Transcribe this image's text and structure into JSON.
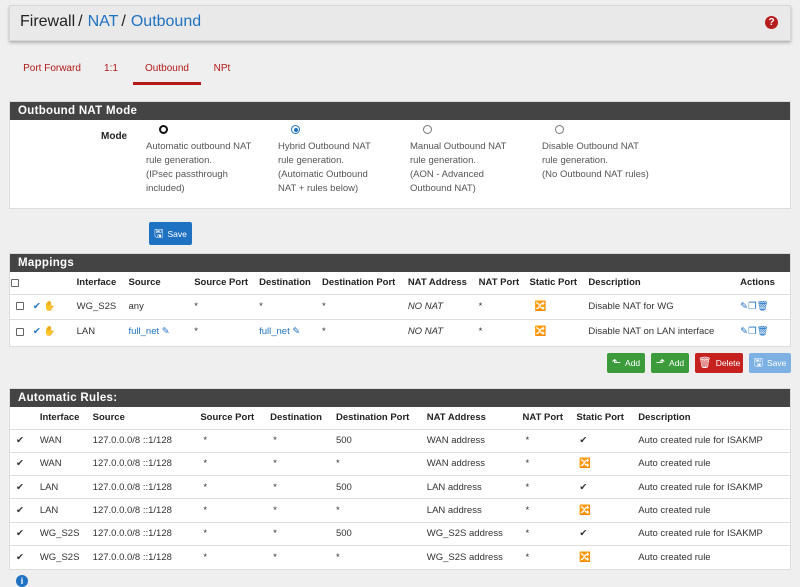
{
  "breadcrumb": {
    "part1": "Firewall",
    "sep1": "/",
    "part2": "NAT",
    "sep2": "/",
    "part3": "Outbound"
  },
  "help_icon": "?",
  "tabs": [
    {
      "label": "Port Forward",
      "active": false
    },
    {
      "label": "1:1",
      "active": false
    },
    {
      "label": "Outbound",
      "active": true
    },
    {
      "label": "NPt",
      "active": false
    }
  ],
  "mode_panel": {
    "title": "Outbound NAT Mode",
    "mode_label": "Mode",
    "options": [
      {
        "lines": [
          "Automatic outbound NAT",
          "rule generation.",
          "(IPsec passthrough",
          "included)"
        ],
        "selected": false,
        "focused": true
      },
      {
        "lines": [
          "Hybrid Outbound NAT",
          "rule generation.",
          "(Automatic Outbound",
          "NAT + rules below)"
        ],
        "selected": true,
        "focused": false
      },
      {
        "lines": [
          "Manual Outbound NAT",
          "rule generation.",
          "(AON - Advanced",
          "Outbound NAT)"
        ],
        "selected": false,
        "focused": false
      },
      {
        "lines": [
          "Disable Outbound NAT",
          "rule generation.",
          "(No Outbound NAT rules)"
        ],
        "selected": false,
        "focused": false
      }
    ],
    "save_label": "Save"
  },
  "mappings": {
    "title": "Mappings",
    "headers": [
      "Interface",
      "Source",
      "Source Port",
      "Destination",
      "Destination Port",
      "NAT Address",
      "NAT Port",
      "Static Port",
      "Description",
      "Actions"
    ],
    "rows": [
      {
        "interface": "WG_S2S",
        "source": "any",
        "source_port": "*",
        "destination": "*",
        "destination_port": "*",
        "nat_address": "NO NAT",
        "nat_port": "*",
        "static_port": "shuffle",
        "description": "Disable NAT for WG"
      },
      {
        "interface": "LAN",
        "source": "full_net",
        "source_port": "*",
        "destination": "full_net",
        "destination_port": "*",
        "nat_address": "NO NAT",
        "nat_port": "*",
        "static_port": "shuffle",
        "description": "Disable NAT on LAN interface"
      }
    ],
    "buttons": {
      "add_top": "Add",
      "add_bottom": "Add",
      "delete": "Delete",
      "save": "Save"
    }
  },
  "auto_rules": {
    "title": "Automatic Rules:",
    "headers": [
      "Interface",
      "Source",
      "Source Port",
      "Destination",
      "Destination Port",
      "NAT Address",
      "NAT Port",
      "Static Port",
      "Description"
    ],
    "rows": [
      {
        "interface": "WAN",
        "source": "127.0.0.0/8 ::1/128",
        "source_port": "*",
        "destination": "*",
        "destination_port": "500",
        "nat_address": "WAN address",
        "nat_port": "*",
        "static_port": "check",
        "description": "Auto created rule for ISAKMP"
      },
      {
        "interface": "WAN",
        "source": "127.0.0.0/8 ::1/128",
        "source_port": "*",
        "destination": "*",
        "destination_port": "*",
        "nat_address": "WAN address",
        "nat_port": "*",
        "static_port": "shuffle",
        "description": "Auto created rule"
      },
      {
        "interface": "LAN",
        "source": "127.0.0.0/8 ::1/128",
        "source_port": "*",
        "destination": "*",
        "destination_port": "500",
        "nat_address": "LAN address",
        "nat_port": "*",
        "static_port": "check",
        "description": "Auto created rule for ISAKMP"
      },
      {
        "interface": "LAN",
        "source": "127.0.0.0/8 ::1/128",
        "source_port": "*",
        "destination": "*",
        "destination_port": "*",
        "nat_address": "LAN address",
        "nat_port": "*",
        "static_port": "shuffle",
        "description": "Auto created rule"
      },
      {
        "interface": "WG_S2S",
        "source": "127.0.0.0/8 ::1/128",
        "source_port": "*",
        "destination": "*",
        "destination_port": "500",
        "nat_address": "WG_S2S address",
        "nat_port": "*",
        "static_port": "check",
        "description": "Auto created rule for ISAKMP"
      },
      {
        "interface": "WG_S2S",
        "source": "127.0.0.0/8 ::1/128",
        "source_port": "*",
        "destination": "*",
        "destination_port": "*",
        "nat_address": "WG_S2S address",
        "nat_port": "*",
        "static_port": "shuffle",
        "description": "Auto created rule"
      }
    ]
  },
  "colors": {
    "accent_red": "#b31919",
    "link_blue": "#1f72c2",
    "header_dark": "#444444",
    "btn_green": "#3c9c3c",
    "btn_red": "#c4211f"
  }
}
